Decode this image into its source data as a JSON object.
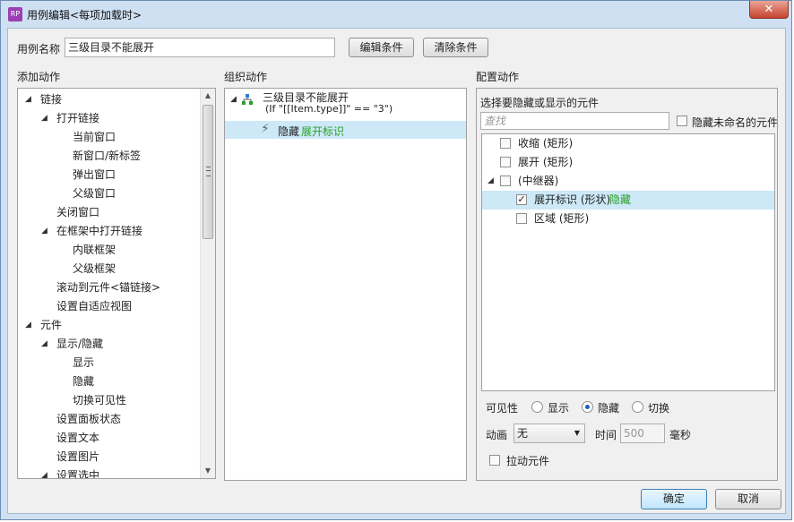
{
  "window": {
    "title": "用例编辑<每项加载时>",
    "app_icon": "RP",
    "close_label": "✕"
  },
  "header": {
    "case_name_label": "用例名称",
    "case_name_value": "三级目录不能展开",
    "edit_condition_label": "编辑条件",
    "clear_condition_label": "清除条件"
  },
  "add_actions": {
    "title": "添加动作",
    "items": [
      {
        "label": "链接",
        "level": 0,
        "expanded": true
      },
      {
        "label": "打开链接",
        "level": 1,
        "expanded": true
      },
      {
        "label": "当前窗口",
        "level": 2
      },
      {
        "label": "新窗口/新标签",
        "level": 2
      },
      {
        "label": "弹出窗口",
        "level": 2
      },
      {
        "label": "父级窗口",
        "level": 2
      },
      {
        "label": "关闭窗口",
        "level": 1
      },
      {
        "label": "在框架中打开链接",
        "level": 1,
        "expanded": true
      },
      {
        "label": "内联框架",
        "level": 2
      },
      {
        "label": "父级框架",
        "level": 2
      },
      {
        "label": "滚动到元件<锚链接>",
        "level": 1
      },
      {
        "label": "设置自适应视图",
        "level": 1
      },
      {
        "label": "元件",
        "level": 0,
        "expanded": true
      },
      {
        "label": "显示/隐藏",
        "level": 1,
        "expanded": true
      },
      {
        "label": "显示",
        "level": 2
      },
      {
        "label": "隐藏",
        "level": 2
      },
      {
        "label": "切换可见性",
        "level": 2
      },
      {
        "label": "设置面板状态",
        "level": 1
      },
      {
        "label": "设置文本",
        "level": 1
      },
      {
        "label": "设置图片",
        "level": 1
      },
      {
        "label": "设置选中",
        "level": 1,
        "expanded": true
      }
    ]
  },
  "organize_actions": {
    "title": "组织动作",
    "case_name": "三级目录不能展开",
    "condition": "(If \"[[Item.type]]\" == \"3\")",
    "action_verb": "隐藏",
    "action_target": "展开标识"
  },
  "configure_actions": {
    "title": "配置动作",
    "subtitle": "选择要隐藏或显示的元件",
    "search_placeholder": "查找",
    "hide_unnamed_label": "隐藏未命名的元件",
    "widgets": [
      {
        "label": "收缩 (矩形)",
        "level": 0,
        "checked": false
      },
      {
        "label": "展开 (矩形)",
        "level": 0,
        "checked": false
      },
      {
        "label": "(中继器)",
        "level": 0,
        "checked": false,
        "expanded": true
      },
      {
        "label": "展开标识 (形状)",
        "level": 1,
        "checked": true,
        "status": "隐藏"
      },
      {
        "label": "区域 (矩形)",
        "level": 1,
        "checked": false
      }
    ],
    "visibility_label": "可见性",
    "visibility_options": [
      "显示",
      "隐藏",
      "切换"
    ],
    "visibility_selected": "隐藏",
    "animation_label": "动画",
    "animation_value": "无",
    "time_label": "时间",
    "time_value": "500",
    "time_unit": "毫秒",
    "pull_widgets_label": "拉动元件"
  },
  "footer": {
    "ok_label": "确定",
    "cancel_label": "取消"
  }
}
